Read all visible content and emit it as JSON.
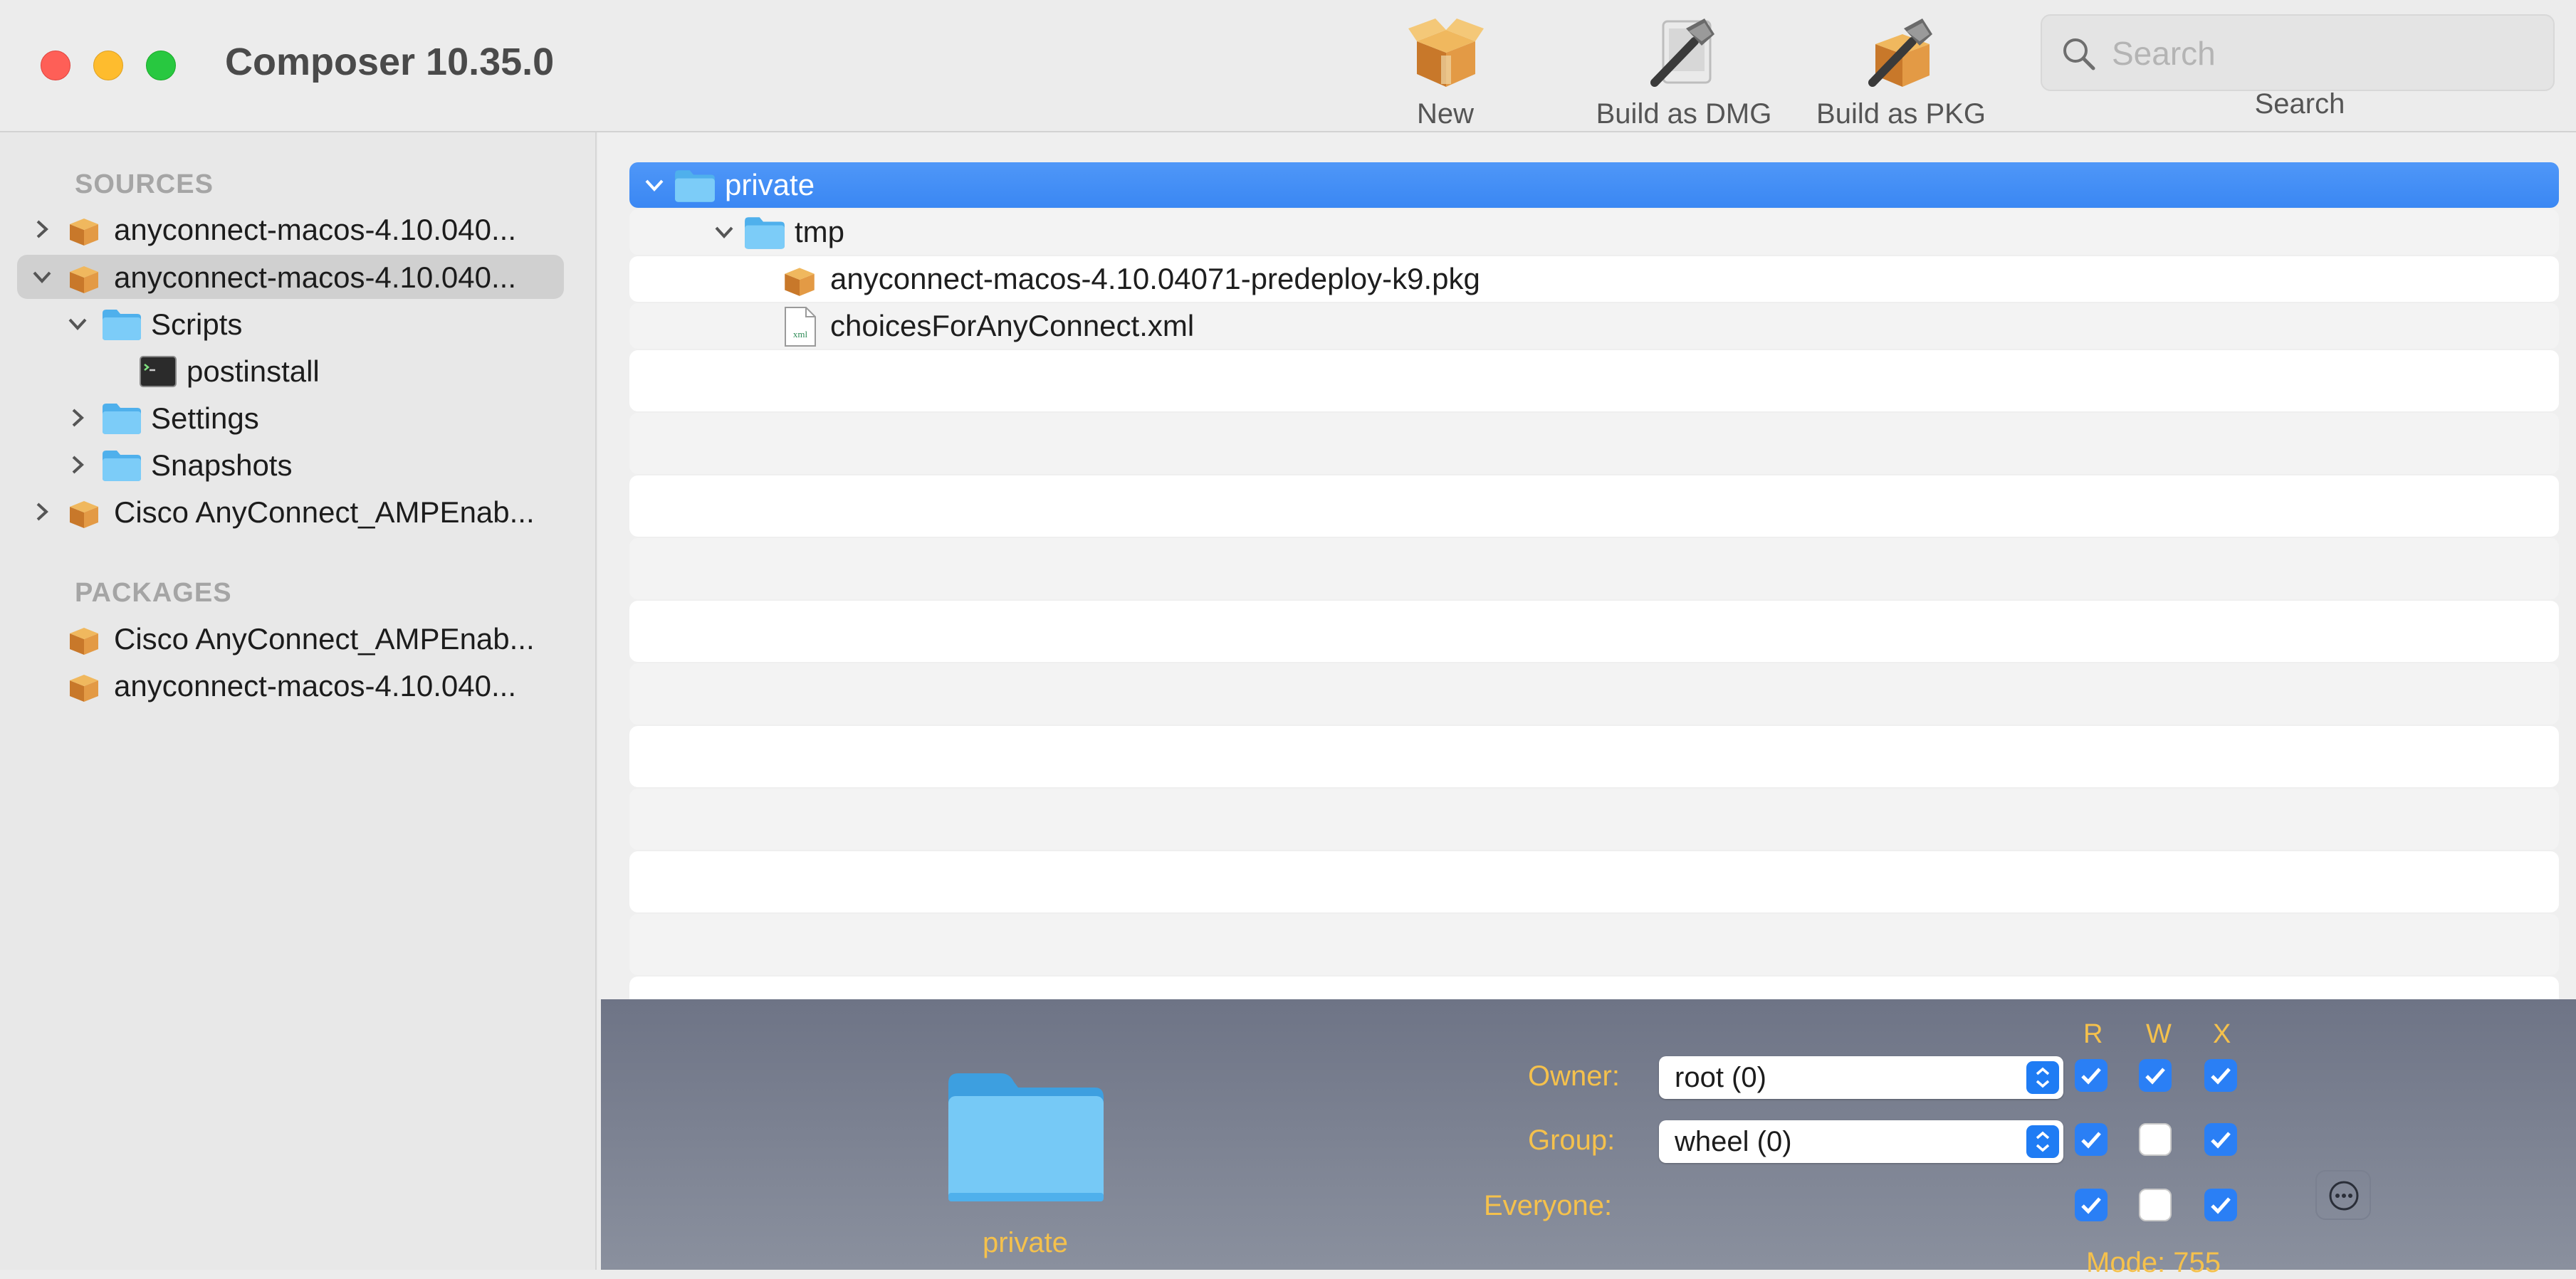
{
  "window": {
    "title": "Composer 10.35.0",
    "traffic_lights": {
      "close": "#fe5f57",
      "minimize": "#febc2e",
      "zoom": "#28c840"
    }
  },
  "toolbar": {
    "new_label": "New",
    "build_dmg_label": "Build as DMG",
    "build_pkg_label": "Build as PKG",
    "search_label": "Search",
    "search_placeholder": "Search"
  },
  "sidebar": {
    "sources_header": "SOURCES",
    "packages_header": "PACKAGES",
    "sources": [
      {
        "label": "anyconnect-macos-4.10.040...",
        "icon": "package-icon",
        "expanded": false
      },
      {
        "label": "anyconnect-macos-4.10.040...",
        "icon": "package-icon",
        "expanded": true,
        "selected": true
      },
      {
        "label": "Scripts",
        "icon": "folder-icon",
        "expanded": true
      },
      {
        "label": "postinstall",
        "icon": "terminal-icon"
      },
      {
        "label": "Settings",
        "icon": "folder-icon",
        "expanded": false
      },
      {
        "label": "Snapshots",
        "icon": "folder-icon",
        "expanded": false
      },
      {
        "label": "Cisco AnyConnect_AMPEnab...",
        "icon": "package-icon",
        "expanded": false
      }
    ],
    "packages": [
      {
        "label": "Cisco AnyConnect_AMPEnab...",
        "icon": "package-icon"
      },
      {
        "label": "anyconnect-macos-4.10.040...",
        "icon": "package-icon"
      }
    ]
  },
  "files": [
    {
      "label": "private",
      "icon": "folder-icon",
      "selected": true
    },
    {
      "label": "tmp",
      "icon": "folder-icon"
    },
    {
      "label": "anyconnect-macos-4.10.04071-predeploy-k9.pkg",
      "icon": "package-icon"
    },
    {
      "label": "choicesForAnyConnect.xml",
      "icon": "xml-file-icon",
      "icon_text": "xml"
    }
  ],
  "info": {
    "item_name": "private",
    "owner_label": "Owner:",
    "owner_value": "root (0)",
    "group_label": "Group:",
    "group_value": "wheel (0)",
    "everyone_label": "Everyone:",
    "col_r": "R",
    "col_w": "W",
    "col_x": "X",
    "mode_text": "Mode: 755",
    "permissions": {
      "owner": {
        "r": true,
        "w": true,
        "x": true
      },
      "group": {
        "r": true,
        "w": false,
        "x": true
      },
      "everyone": {
        "r": true,
        "w": false,
        "x": true
      }
    }
  }
}
